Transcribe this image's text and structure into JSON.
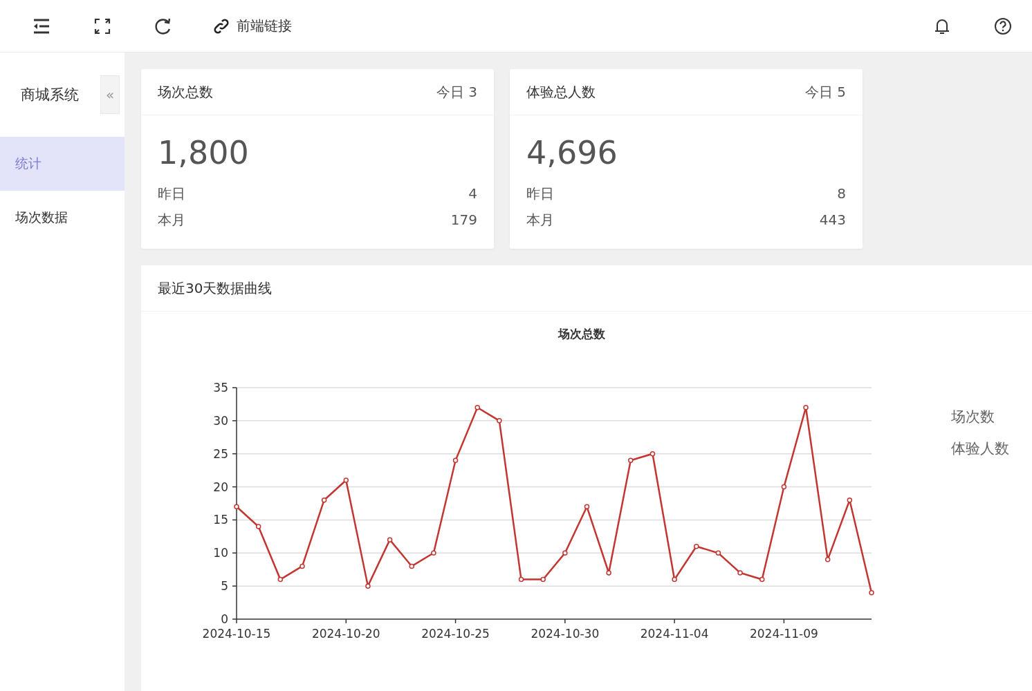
{
  "toolbar": {
    "link_label": "前端链接"
  },
  "sidebar": {
    "title": "商城系统",
    "collapse_label": "«",
    "items": [
      {
        "label": "统计",
        "selected": true
      },
      {
        "label": "场次数据",
        "selected": false
      }
    ]
  },
  "cards": [
    {
      "title": "场次总数",
      "today": "今日 3",
      "total": "1,800",
      "rows": [
        {
          "label": "昨日",
          "value": "4"
        },
        {
          "label": "本月",
          "value": "179"
        }
      ]
    },
    {
      "title": "体验总人数",
      "today": "今日 5",
      "total": "4,696",
      "rows": [
        {
          "label": "昨日",
          "value": "8"
        },
        {
          "label": "本月",
          "value": "443"
        }
      ]
    }
  ],
  "panel": {
    "title": "最近30天数据曲线",
    "other_legend_items": [
      "体验人数"
    ],
    "chart_data": {
      "type": "line",
      "title": "场次总数",
      "categories": [
        "2024-10-15",
        null,
        null,
        null,
        null,
        "2024-10-20",
        null,
        null,
        null,
        null,
        "2024-10-25",
        null,
        null,
        null,
        null,
        "2024-10-30",
        null,
        null,
        null,
        null,
        "2024-11-04",
        null,
        null,
        null,
        null,
        "2024-11-09",
        null,
        null,
        null,
        null
      ],
      "grid": true,
      "series": [
        {
          "name": "场次数",
          "color": "#c23531",
          "marker": true,
          "values": [
            17,
            14,
            6,
            8,
            18,
            21,
            5,
            12,
            8,
            10,
            24,
            32,
            30,
            6,
            6,
            10,
            17,
            7,
            24,
            25,
            6,
            11,
            10,
            7,
            6,
            20,
            32,
            9,
            18,
            4
          ]
        }
      ],
      "ylim": [
        0,
        35
      ],
      "yticks": [
        0,
        5,
        10,
        15,
        20,
        25,
        30,
        35
      ]
    }
  }
}
